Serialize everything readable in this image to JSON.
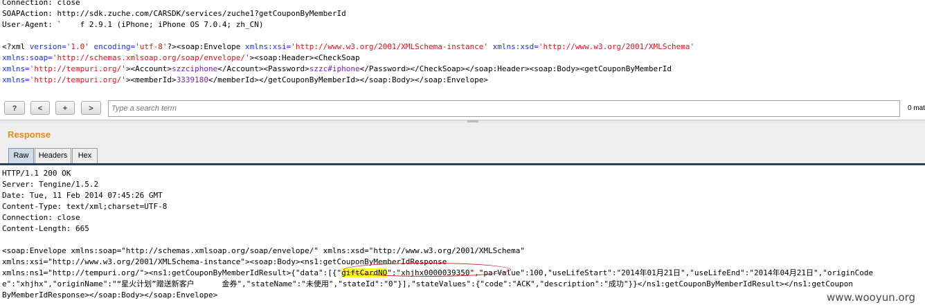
{
  "request": {
    "header_lines": [
      "Connection: close",
      "SOAPAction: http://sdk.zuche.com/CARSDK/services/zuche1?getCouponByMemberId",
      "User-Agent: `    f 2.9.1 (iPhone; iPhone OS 7.0.4; zh_CN)"
    ],
    "body_lines": [
      [
        {
          "t": "<?xml ",
          "c": ""
        },
        {
          "t": "version=",
          "c": "blue"
        },
        {
          "t": "'1.0'",
          "c": "red"
        },
        {
          "t": " ",
          "c": ""
        },
        {
          "t": "encoding=",
          "c": "blue"
        },
        {
          "t": "'utf-8'",
          "c": "red"
        },
        {
          "t": "?><soap:Envelope ",
          "c": ""
        },
        {
          "t": "xmlns:xsi=",
          "c": "blue"
        },
        {
          "t": "'http://www.w3.org/2001/XMLSchema-instance'",
          "c": "red"
        },
        {
          "t": " ",
          "c": ""
        },
        {
          "t": "xmlns:xsd=",
          "c": "blue"
        },
        {
          "t": "'http://www.w3.org/2001/XMLSchema'",
          "c": "red"
        }
      ],
      [
        {
          "t": "xmlns:soap=",
          "c": "blue"
        },
        {
          "t": "'http://schemas.xmlsoap.org/soap/envelope/'",
          "c": "red"
        },
        {
          "t": "><soap:Header><CheckSoap",
          "c": ""
        }
      ],
      [
        {
          "t": "xmlns=",
          "c": "blue"
        },
        {
          "t": "'http://tempuri.org/'",
          "c": "red"
        },
        {
          "t": "><Account>",
          "c": ""
        },
        {
          "t": "szzciphone",
          "c": "purple"
        },
        {
          "t": "</Account><Password>",
          "c": ""
        },
        {
          "t": "szzc#iphone",
          "c": "purple"
        },
        {
          "t": "</Password></CheckSoap></soap:Header><soap:Body><getCouponByMemberId",
          "c": ""
        }
      ],
      [
        {
          "t": "xmlns=",
          "c": "blue"
        },
        {
          "t": "'http://tempuri.org/'",
          "c": "red"
        },
        {
          "t": "><memberId>",
          "c": ""
        },
        {
          "t": "3339180",
          "c": "purple"
        },
        {
          "t": "</memberId></getCouponByMemberId></soap:Body></soap:Envelope>",
          "c": ""
        }
      ]
    ]
  },
  "search": {
    "help_label": "?",
    "prev_label": "<",
    "add_label": "+",
    "next_label": ">",
    "placeholder": "Type a search term",
    "match_count": "0 mat"
  },
  "response": {
    "title": "Response",
    "tabs": [
      {
        "label": "Raw",
        "active": true
      },
      {
        "label": "Headers",
        "active": false
      },
      {
        "label": "Hex",
        "active": false
      }
    ],
    "lines": [
      [
        {
          "t": "HTTP/1.1 200 OK",
          "c": ""
        }
      ],
      [
        {
          "t": "Server: Tengine/1.5.2",
          "c": ""
        }
      ],
      [
        {
          "t": "Date: Tue, 11 Feb 2014 07:45:26 GMT",
          "c": ""
        }
      ],
      [
        {
          "t": "Content-Type: text/xml;charset=UTF-8",
          "c": ""
        }
      ],
      [
        {
          "t": "Connection: close",
          "c": ""
        }
      ],
      [
        {
          "t": "Content-Length: 665",
          "c": ""
        }
      ],
      [
        {
          "t": "",
          "c": ""
        }
      ],
      [
        {
          "t": "<soap:Envelope xmlns:soap=\"http://schemas.xmlsoap.org/soap/envelope/\" xmlns:xsd=\"http://www.w3.org/2001/XMLSchema\"",
          "c": ""
        }
      ],
      [
        {
          "t": "xmlns:xsi=\"http://www.w3.org/2001/XMLSchema-instance\"><soap:Body><ns1:getCouponByMemberIdResponse",
          "c": ""
        }
      ],
      [
        {
          "t": "xmlns:ns1=\"http://tempuri.org/\"><ns1:getCouponByMemberIdResult>{\"data\":[{\"",
          "c": ""
        },
        {
          "t": "giftCardNO",
          "c": "yellow"
        },
        {
          "t": "\":\"xhjhx0000039350\",\"parValue\":100,\"useLifeStart\":\"2014年01月21日\",\"useLifeEnd\":\"2014年04月21日\",\"originCode",
          "c": ""
        }
      ],
      [
        {
          "t": "e\":\"xhjhx\",\"originName\":\"“星火计划”赠送新客户      金券\",\"stateName\":\"未使用\",\"stateId\":\"0\"}],\"stateValues\":{\"code\":\"ACK\",\"description\":\"成功\"}}</ns1:getCouponByMemberIdResult></ns1:getCoupon",
          "c": ""
        }
      ],
      [
        {
          "t": "ByMemberIdResponse></soap:Body></soap:Envelope>",
          "c": ""
        }
      ]
    ]
  },
  "watermark": "www.wooyun.org",
  "colors": {
    "attribute": "#1c33d4",
    "string": "#cc1a1a",
    "value": "#7a1fa8",
    "response_title": "#e58a1f",
    "highlight": "#ffff33",
    "annotation": "#d2171c"
  }
}
